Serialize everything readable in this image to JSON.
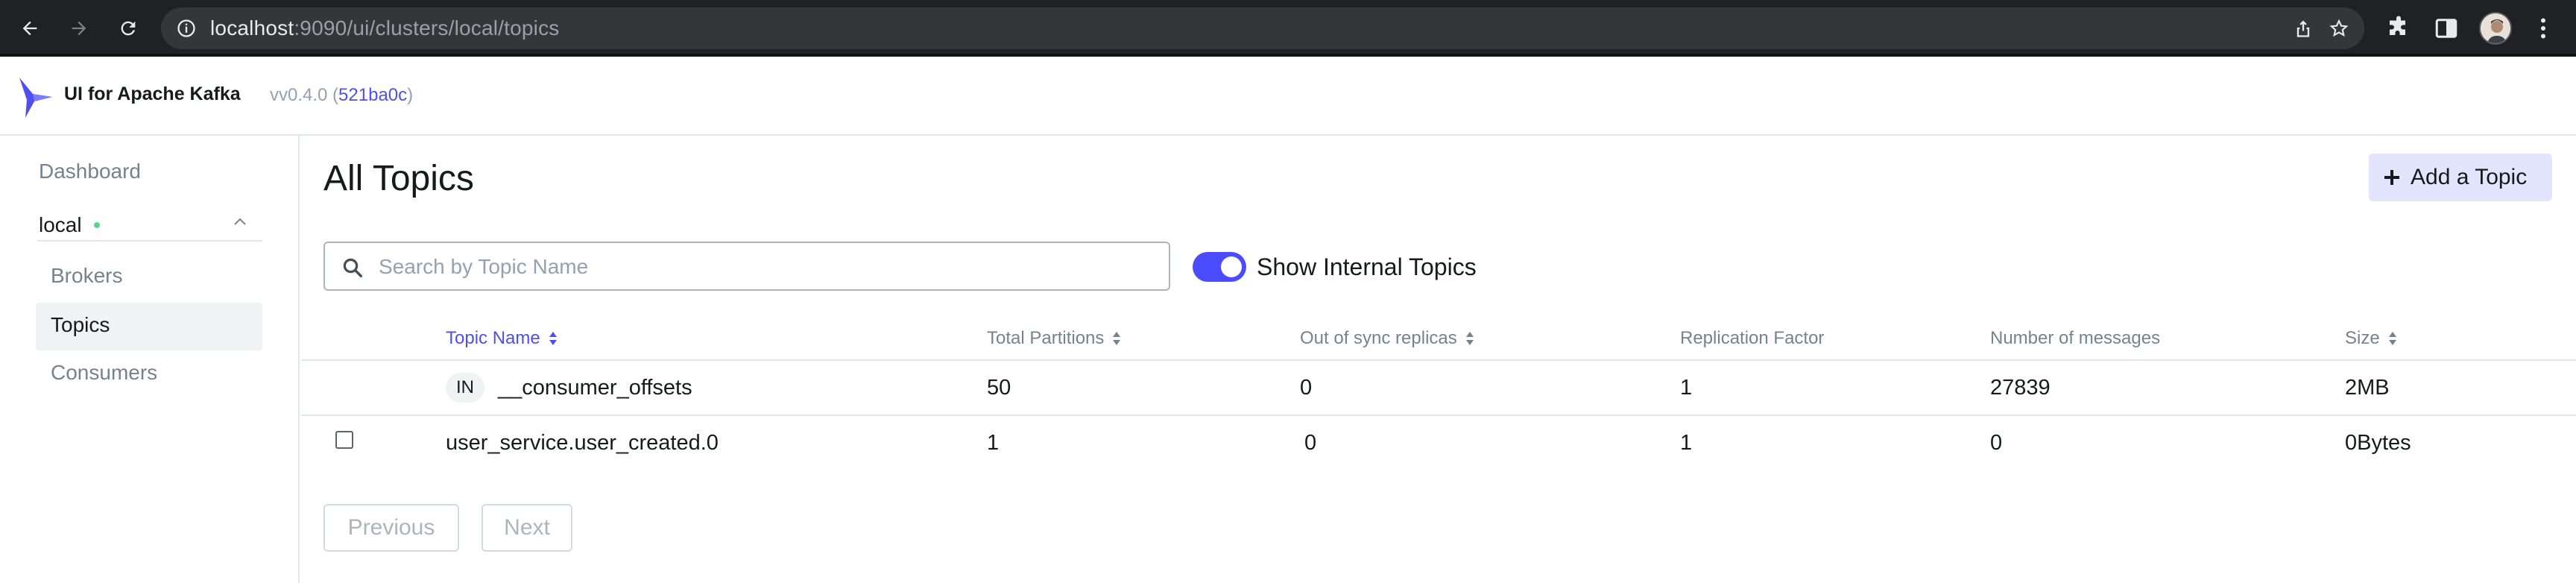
{
  "browser": {
    "url_host": "localhost",
    "url_path": ":9090/ui/clusters/local/topics"
  },
  "header": {
    "brand": "UI for Apache Kafka",
    "version_prefix": "vv0.4.0 (",
    "commit": "521ba0c",
    "version_suffix": ")"
  },
  "sidebar": {
    "dashboard": "Dashboard",
    "cluster_name": "local",
    "items": [
      {
        "label": "Brokers"
      },
      {
        "label": "Topics"
      },
      {
        "label": "Consumers"
      }
    ]
  },
  "main": {
    "title": "All Topics",
    "add_topic_label": "Add a Topic",
    "search_placeholder": "Search by Topic Name",
    "search_value": "",
    "show_internal_label": "Show Internal Topics",
    "show_internal_on": true
  },
  "table": {
    "columns": [
      {
        "label": "Topic Name"
      },
      {
        "label": "Total Partitions"
      },
      {
        "label": "Out of sync replicas"
      },
      {
        "label": "Replication Factor"
      },
      {
        "label": "Number of messages"
      },
      {
        "label": "Size"
      }
    ],
    "rows": [
      {
        "badge": "IN",
        "name": "__consumer_offsets",
        "partitions": "50",
        "out_of_sync": "0",
        "replication": "1",
        "messages": "27839",
        "size": "2MB"
      },
      {
        "badge": "",
        "name": "user_service.user_created.0",
        "partitions": "1",
        "out_of_sync": "0",
        "replication": "1",
        "messages": "0",
        "size": "0Bytes"
      }
    ]
  },
  "pagination": {
    "previous": "Previous",
    "next": "Next"
  },
  "colors": {
    "accent": "#4f4ff0",
    "toggle_on": "#4c4cff",
    "status_online": "#5cd685"
  }
}
